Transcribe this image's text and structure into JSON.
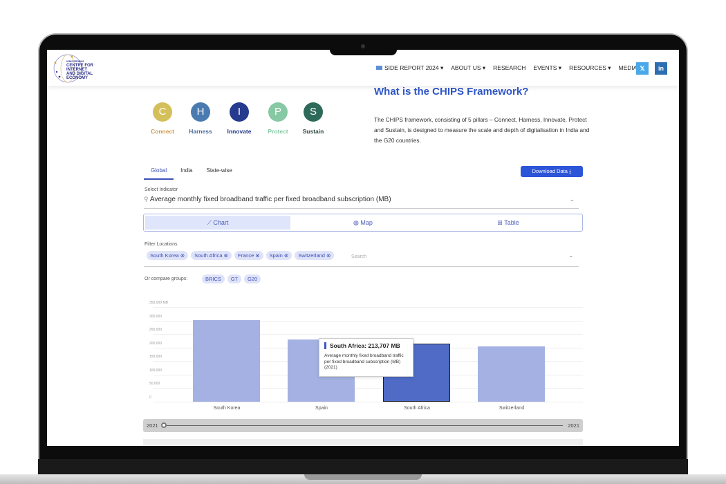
{
  "nav": {
    "logo_text": [
      "IGNIS PROBUS",
      "CENTRE FOR",
      "INTERNET",
      "AND DIGITAL",
      "ECONOMY"
    ],
    "items": [
      {
        "label": "SIDE REPORT 2024",
        "dropdown": true,
        "badge": "NEW"
      },
      {
        "label": "ABOUT US",
        "dropdown": true
      },
      {
        "label": "RESEARCH"
      },
      {
        "label": "EVENTS",
        "dropdown": true
      },
      {
        "label": "RESOURCES",
        "dropdown": true
      },
      {
        "label": "MEDIA"
      }
    ],
    "social": [
      {
        "icon": "x-icon",
        "glyph": "𝕏",
        "color": "#4aa8e8"
      },
      {
        "icon": "linkedin-icon",
        "glyph": "in",
        "color": "#2d6fb0"
      }
    ]
  },
  "pillars": [
    {
      "letter": "C",
      "label": "Connect",
      "color": "#d4bf5a",
      "text_color": "#d09a4a"
    },
    {
      "letter": "H",
      "label": "Harness",
      "color": "#4a7bb0",
      "text_color": "#4a6a9a"
    },
    {
      "letter": "I",
      "label": "Innovate",
      "color": "#263a8e",
      "text_color": "#263a8e"
    },
    {
      "letter": "P",
      "label": "Protect",
      "color": "#86c9a4",
      "text_color": "#86c9a4"
    },
    {
      "letter": "S",
      "label": "Sustain",
      "color": "#2e6a5a",
      "text_color": "#2e4a44"
    }
  ],
  "intro": {
    "title": "What is the CHIPS Framework?",
    "text": "The CHIPS framework, consisting of 5 pillars – Connect, Harness, Innovate, Protect and Sustain, is designed to measure the scale and depth of digitalisation in India and the G20 countries."
  },
  "tabs": [
    {
      "label": "Global",
      "active": true
    },
    {
      "label": "India"
    },
    {
      "label": "State-wise"
    }
  ],
  "download_label": "Download Data",
  "indicator": {
    "label": "Select Indicator",
    "value": "Average monthly fixed broadband traffic per fixed broadband subscription (MB)"
  },
  "views": [
    {
      "label": "Chart",
      "icon": "line-chart-icon",
      "glyph": "📈",
      "active": true
    },
    {
      "label": "Map",
      "icon": "globe-icon",
      "glyph": "🌐"
    },
    {
      "label": "Table",
      "icon": "table-icon",
      "glyph": "▦"
    }
  ],
  "filter": {
    "label": "Filter Locations",
    "chips": [
      "South Korea",
      "South Africa",
      "France",
      "Spain",
      "Switzerland"
    ],
    "placeholder": "Search"
  },
  "groups": {
    "label": "Or compare groups:",
    "items": [
      "BRICS",
      "G7",
      "G20"
    ]
  },
  "chart_data": {
    "type": "bar",
    "categories": [
      "South Korea",
      "Spain",
      "South Africa",
      "Switzerland"
    ],
    "values": [
      301000,
      230000,
      213707,
      204000
    ],
    "ylim": [
      0,
      350000
    ],
    "yticks": [
      "0",
      "50,000",
      "100,000",
      "150,000",
      "200,000",
      "250,000",
      "300,000",
      "350,000 MB"
    ],
    "highlight": "South Africa",
    "bar_color": "#a4b1e2",
    "highlight_color": "#4f6bc6",
    "grid": true
  },
  "tooltip": {
    "title": "South Africa: 213,707 MB",
    "text": "Average monthly fixed broadband traffic per fixed broadband subscription (MB) (2021)"
  },
  "slider": {
    "start": "2021",
    "end": "2021",
    "value": "2021"
  }
}
